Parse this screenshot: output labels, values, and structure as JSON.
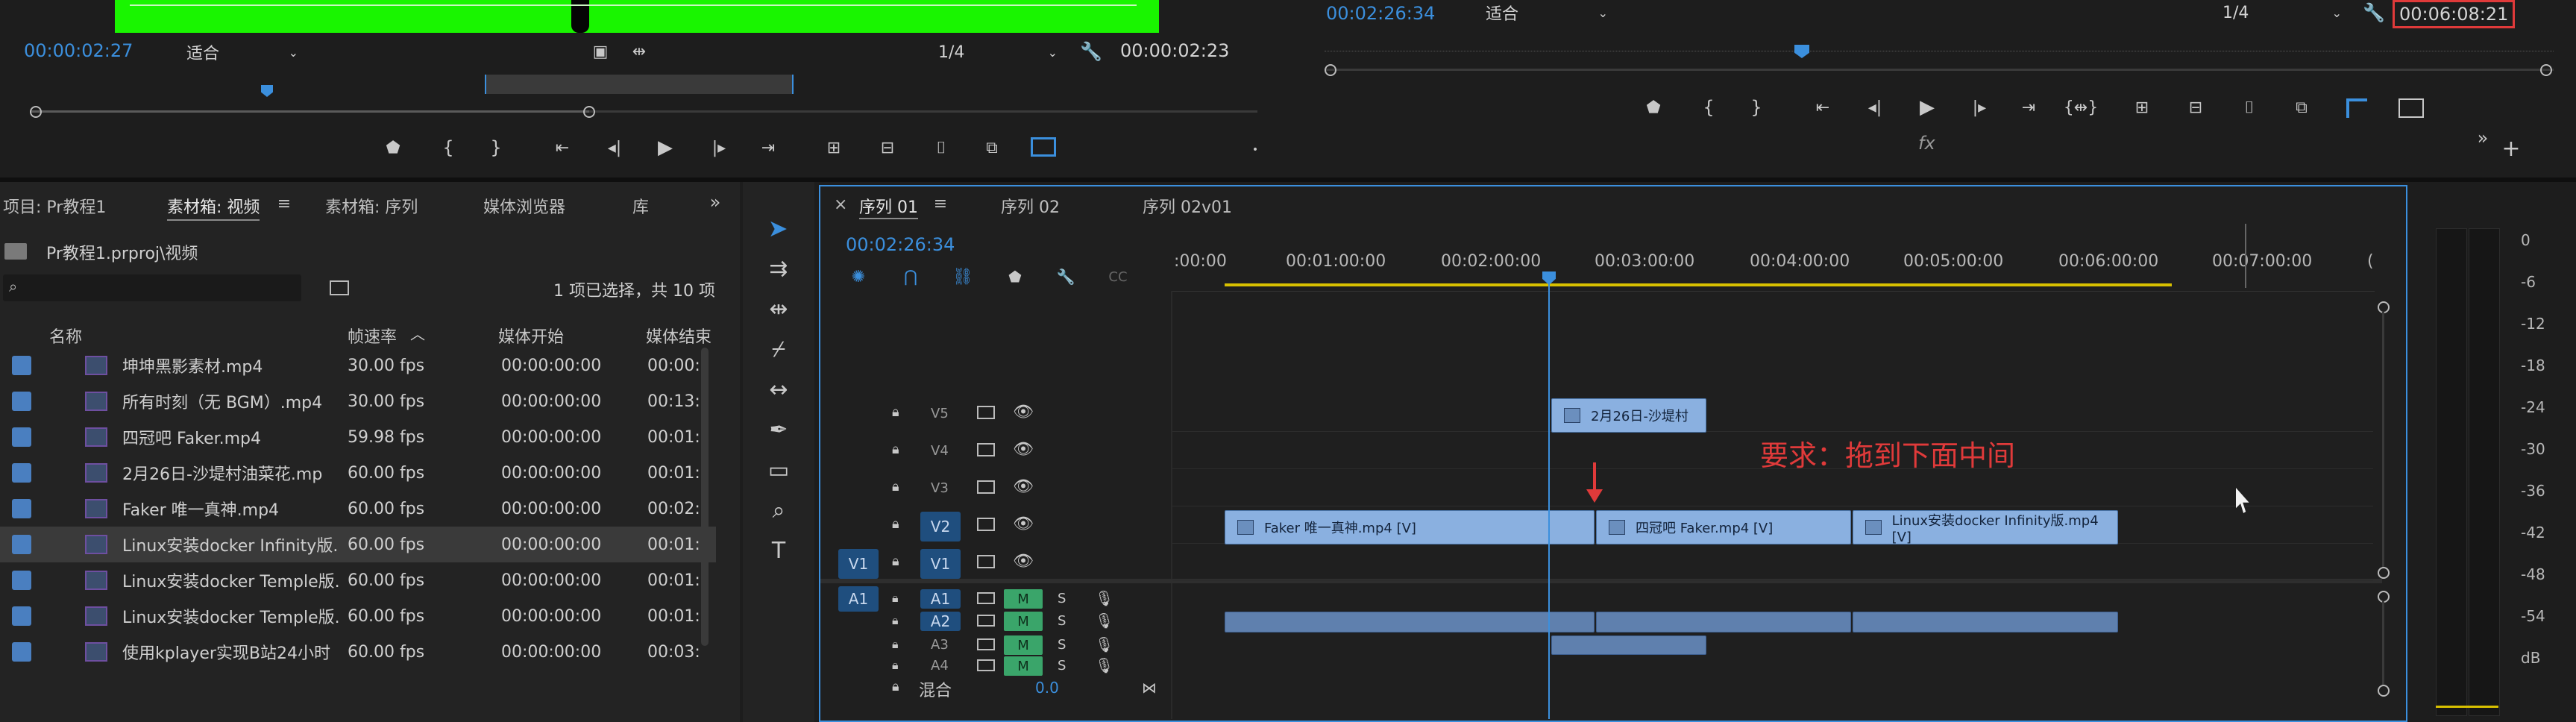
{
  "source_monitor": {
    "timecode": "00:00:02:27",
    "fit": "适合",
    "resolution": "1/4",
    "duration": "00:00:02:23"
  },
  "program_monitor": {
    "timecode": "00:02:26:34",
    "fit": "适合",
    "resolution": "1/4",
    "duration": "00:06:08:21",
    "fx_label": "fx"
  },
  "project_panel": {
    "tabs": [
      "项目: Pr教程1",
      "素材箱: 视频",
      "素材箱: 序列",
      "媒体浏览器",
      "库"
    ],
    "path": "Pr教程1.prproj\\视频",
    "selection_info": "1 项已选择，共 10 项",
    "columns": [
      "名称",
      "帧速率",
      "媒体开始",
      "媒体结束"
    ],
    "rows": [
      {
        "name": "坤坤黑影素材.mp4",
        "fps": "30.00 fps",
        "start": "00:00:00:00",
        "end": "00:00:"
      },
      {
        "name": "所有时刻（无 BGM）.mp4",
        "fps": "30.00 fps",
        "start": "00:00:00:00",
        "end": "00:13:"
      },
      {
        "name": "四冠吧 Faker.mp4",
        "fps": "59.98 fps",
        "start": "00:00:00:00",
        "end": "00:01:"
      },
      {
        "name": "2月26日-沙堤村油菜花.mp",
        "fps": "60.00 fps",
        "start": "00:00:00:00",
        "end": "00:01:"
      },
      {
        "name": "Faker 唯一真神.mp4",
        "fps": "60.00 fps",
        "start": "00:00:00:00",
        "end": "00:02:"
      },
      {
        "name": "Linux安装docker Infinity版.",
        "fps": "60.00 fps",
        "start": "00:00:00:00",
        "end": "00:01:"
      },
      {
        "name": "Linux安装docker Temple版.",
        "fps": "60.00 fps",
        "start": "00:00:00:00",
        "end": "00:01:"
      },
      {
        "name": "Linux安装docker Temple版.",
        "fps": "60.00 fps",
        "start": "00:00:00:00",
        "end": "00:01:"
      },
      {
        "name": "使用kplayer实现B站24小时",
        "fps": "60.00 fps",
        "start": "00:00:00:00",
        "end": "00:03:"
      }
    ]
  },
  "timeline": {
    "tabs": [
      "序列 01",
      "序列 02",
      "序列 02v01"
    ],
    "timecode": "00:02:26:34",
    "ruler": [
      ":00:00",
      "00:01:00:00",
      "00:02:00:00",
      "00:03:00:00",
      "00:04:00:00",
      "00:05:00:00",
      "00:06:00:00",
      "00:07:00:00",
      "("
    ],
    "video_tracks": [
      "V5",
      "V4",
      "V3",
      "V2",
      "V1"
    ],
    "audio_tracks": [
      "A1",
      "A2",
      "A3",
      "A4"
    ],
    "source_v": "V1",
    "source_a": "A1",
    "mute": "M",
    "solo": "S",
    "mix_label": "混合",
    "mix_value": "0.0",
    "clips": {
      "v5": "2月26日-沙堤村",
      "v2a": "Faker 唯一真神.mp4 [V]",
      "v2b": "四冠吧 Faker.mp4 [V]",
      "v2c": "Linux安装docker Infinity版.mp4 [V]"
    },
    "annotation": "要求：拖到下面中间"
  },
  "audio_meter": {
    "labels": [
      "0",
      "-6",
      "-12",
      "-18",
      "-24",
      "-30",
      "-36",
      "-42",
      "-48",
      "-54",
      "dB"
    ]
  },
  "colors": {
    "accent": "#3b8fdd",
    "annotation": "#e03a3a",
    "video_clip": "#8ab0e0",
    "audio_clip": "#5f80ae",
    "mute": "#3aa56a",
    "green_screen": "#19f500"
  }
}
